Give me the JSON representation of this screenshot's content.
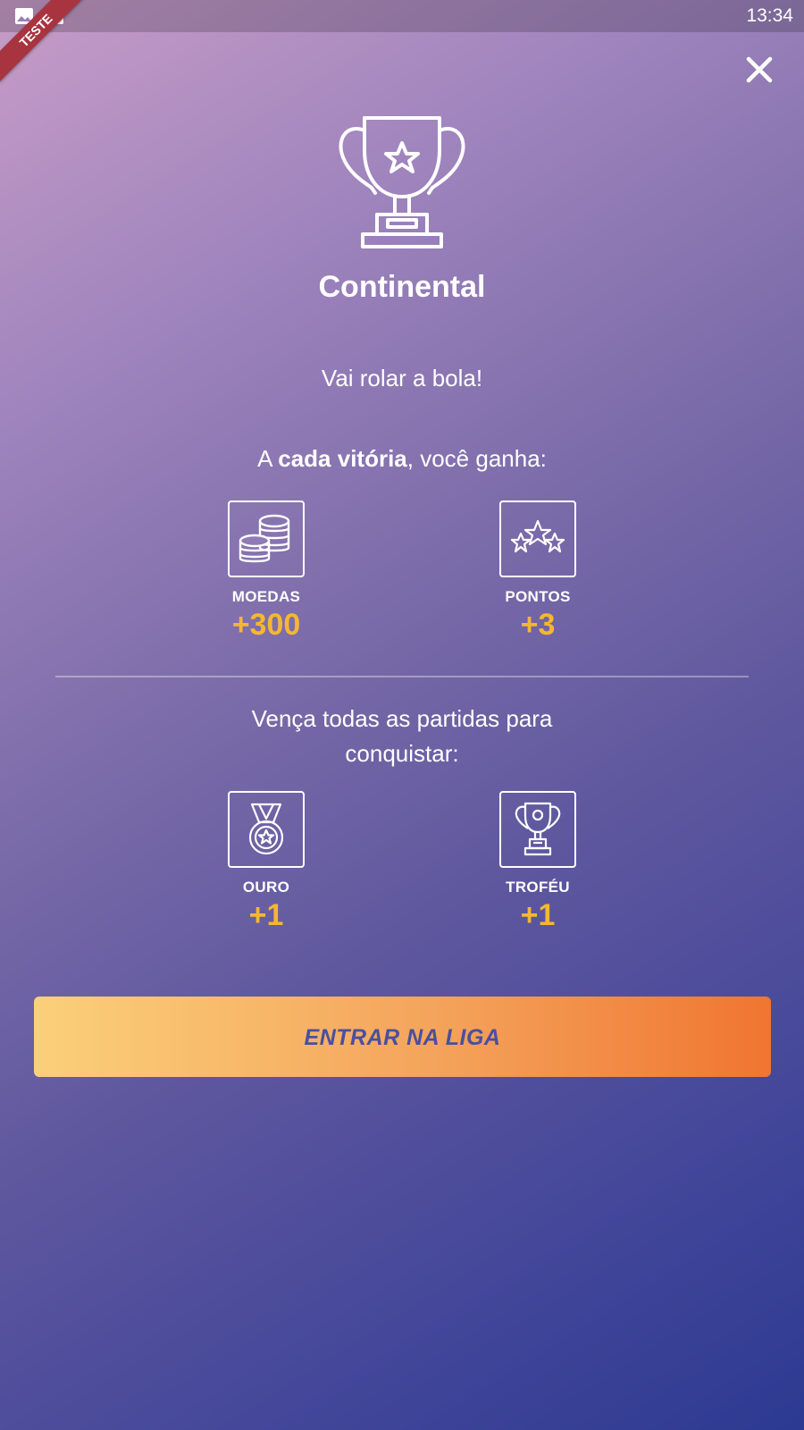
{
  "status_bar": {
    "time": "13:34",
    "ribbon": "TESTE"
  },
  "header": {
    "title": "Continental",
    "subtitle": "Vai rolar a bola!"
  },
  "per_win": {
    "prefix": "A ",
    "emphasis": "cada vitória",
    "suffix": ", você ganha:",
    "rewards": [
      {
        "label": "MOEDAS",
        "value": "+300",
        "icon": "coins-icon"
      },
      {
        "label": "PONTOS",
        "value": "+3",
        "icon": "stars-icon"
      }
    ]
  },
  "conquer": {
    "text": "Vença todas as partidas para conquistar:",
    "rewards": [
      {
        "label": "OURO",
        "value": "+1",
        "icon": "medal-icon"
      },
      {
        "label": "TROFÉU",
        "value": "+1",
        "icon": "trophy-icon"
      }
    ]
  },
  "cta": {
    "label": "ENTRAR NA LIGA"
  },
  "colors": {
    "accent": "#f5b731",
    "button_text": "#4a4fa0",
    "ribbon": "#a8343f"
  }
}
